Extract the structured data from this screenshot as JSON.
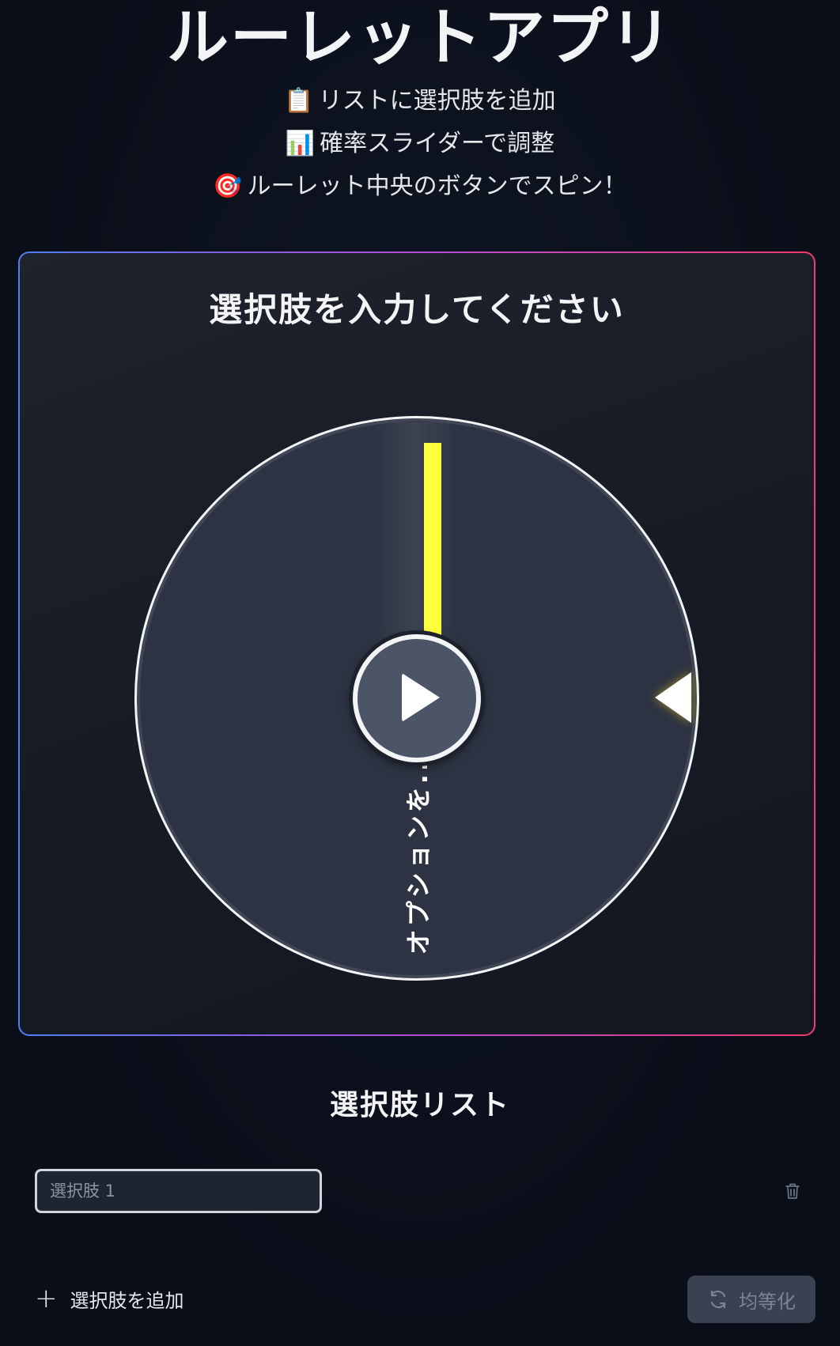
{
  "app": {
    "title": "ルーレットアプリ"
  },
  "instructions": [
    {
      "emoji": "📋",
      "text": "リストに選択肢を追加"
    },
    {
      "emoji": "📊",
      "text": "確率スライダーで調整"
    },
    {
      "emoji": "🎯",
      "text": "ルーレット中央のボタンでスピン！"
    }
  ],
  "wheel": {
    "result_heading": "選択肢を入力してください",
    "segment_label": "オプションを...",
    "spin_icon": "play-icon",
    "pointer_icon": "triangle-pointer-icon",
    "colors": {
      "wheel_fill": "#2d3342",
      "wheel_rim": "#ffffff",
      "marker": "#ffff3d",
      "pointer_glow": "#facc15"
    }
  },
  "options_list": {
    "title": "選択肢リスト",
    "items": [
      {
        "value": "",
        "placeholder": "選択肢 1",
        "delete_icon": "trash-icon"
      }
    ],
    "add_button_label": "選択肢を追加",
    "add_icon": "plus-icon",
    "equalize_button_label": "均等化",
    "equalize_icon": "refresh-icon"
  },
  "colors": {
    "background": "#0b0f1a",
    "card_border_start": "#4f7df3",
    "card_border_end": "#f13a6e"
  }
}
